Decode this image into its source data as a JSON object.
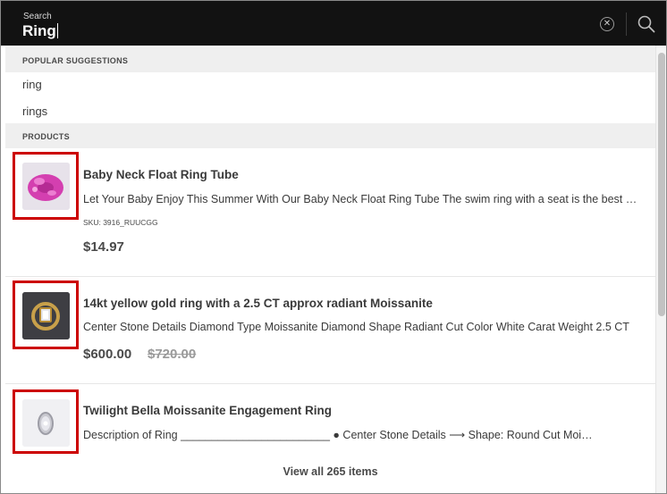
{
  "search": {
    "caption": "Search",
    "value": "Ring",
    "clear_icon": "close-circle-icon",
    "search_icon": "search-icon"
  },
  "suggestions": {
    "header": "POPULAR SUGGESTIONS",
    "items": [
      "ring",
      "rings"
    ]
  },
  "products": {
    "header": "PRODUCTS",
    "items": [
      {
        "name": "Baby Neck Float Ring Tube",
        "description": "Let Your Baby Enjoy This Summer With Our Baby Neck Float Ring Tube The swim ring with a seat is the best choice for your baby",
        "sku": "SKU: 3916_RUUCGG",
        "price": "$14.97",
        "thumbnail": "pink-float-ring-image"
      },
      {
        "name": "14kt yellow gold ring with a 2.5 CT approx radiant Moissanite",
        "description": "Center Stone Details Diamond Type Moissanite Diamond Shape Radiant Cut Color White Carat Weight 2.5 CT",
        "price": "$600.00",
        "old_price": "$720.00",
        "thumbnail": "gold-ring-image"
      },
      {
        "name": "Twilight Bella Moissanite Engagement Ring",
        "description": "Description of Ring ________________________ ● Center Stone Details ⟶ Shape: Round Cut Moissanite",
        "thumbnail": "silver-ring-image"
      }
    ]
  },
  "view_all": "View all 265 items",
  "colors": {
    "search_bg": "#121212",
    "highlight": "#cc0000",
    "section_bg": "#efefef"
  }
}
